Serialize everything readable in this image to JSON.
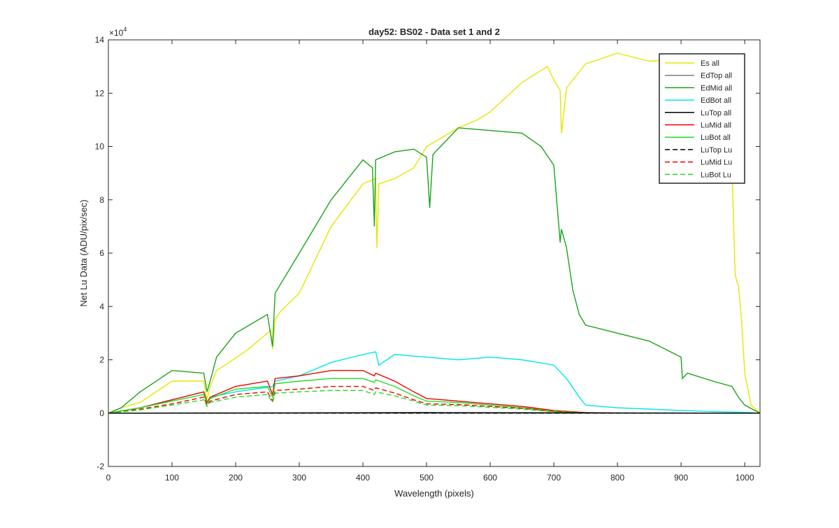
{
  "chart_data": {
    "type": "line",
    "title": "day52: BS02 - Data set 1 and 2",
    "xlabel": "Wavelength (pixels)",
    "ylabel": "Net Lu Data (ADU/pix/sec)",
    "y_exponent_label": "×10",
    "y_exponent_power": "4",
    "xlim": [
      0,
      1024
    ],
    "ylim": [
      -2,
      14
    ],
    "xticks": [
      0,
      100,
      200,
      300,
      400,
      500,
      600,
      700,
      800,
      900,
      1000
    ],
    "yticks": [
      -2,
      0,
      2,
      4,
      6,
      8,
      10,
      12,
      14
    ],
    "legend_position": "top-right",
    "series": [
      {
        "name": "Es  all",
        "color": "#e6e600",
        "dash": "solid",
        "x": [
          0,
          20,
          50,
          100,
          150,
          155,
          160,
          170,
          190,
          220,
          240,
          255,
          258,
          262,
          270,
          300,
          350,
          400,
          420,
          422,
          425,
          450,
          480,
          500,
          550,
          580,
          600,
          650,
          690,
          700,
          710,
          712,
          720,
          750,
          800,
          850,
          900,
          950,
          975,
          980,
          985,
          988,
          990,
          995,
          1000,
          1010,
          1024
        ],
        "y": [
          0,
          0.2,
          0.4,
          1.2,
          1.2,
          0.5,
          1.0,
          1.6,
          1.9,
          2.4,
          2.8,
          3.1,
          2.4,
          3.5,
          3.8,
          4.5,
          7.0,
          8.6,
          8.8,
          6.2,
          8.6,
          8.8,
          9.2,
          10.0,
          10.7,
          11.0,
          11.3,
          12.4,
          13.0,
          12.5,
          12.1,
          10.5,
          12.2,
          13.1,
          13.5,
          13.2,
          13.3,
          13.3,
          13.0,
          9.0,
          5.2,
          4.9,
          4.8,
          3.5,
          1.5,
          0.3,
          0
        ]
      },
      {
        "name": "EdTop  all",
        "color": "#808080",
        "dash": "solid",
        "x": [
          0,
          500,
          1024
        ],
        "y": [
          0,
          0,
          0
        ]
      },
      {
        "name": "EdMid  all",
        "color": "#1aa31a",
        "dash": "solid",
        "x": [
          0,
          20,
          50,
          100,
          150,
          155,
          160,
          170,
          200,
          250,
          258,
          262,
          300,
          350,
          400,
          415,
          418,
          420,
          450,
          480,
          500,
          505,
          510,
          550,
          600,
          650,
          680,
          700,
          710,
          712,
          720,
          730,
          740,
          750,
          800,
          850,
          900,
          902,
          910,
          950,
          980,
          990,
          1000,
          1024
        ],
        "y": [
          0,
          0.2,
          0.8,
          1.6,
          1.5,
          0.8,
          1.2,
          2.1,
          3.0,
          3.7,
          2.5,
          4.5,
          6.0,
          8.0,
          9.5,
          9.2,
          7.0,
          9.5,
          9.8,
          9.9,
          9.6,
          7.7,
          9.7,
          10.7,
          10.6,
          10.5,
          10.0,
          9.3,
          6.4,
          6.9,
          6.2,
          4.6,
          3.7,
          3.3,
          3.0,
          2.7,
          2.1,
          1.3,
          1.5,
          1.2,
          1.0,
          0.6,
          0.3,
          0
        ]
      },
      {
        "name": "EdBot  all",
        "color": "#00e5ee",
        "dash": "solid",
        "x": [
          0,
          50,
          100,
          150,
          155,
          160,
          200,
          258,
          262,
          300,
          350,
          400,
          420,
          425,
          450,
          500,
          550,
          600,
          650,
          700,
          720,
          740,
          750,
          800,
          850,
          900,
          950,
          1000,
          1024
        ],
        "y": [
          0,
          0.2,
          0.5,
          0.8,
          0.4,
          0.6,
          0.8,
          1.0,
          1.2,
          1.4,
          1.9,
          2.2,
          2.3,
          1.8,
          2.2,
          2.1,
          2.0,
          2.1,
          2.0,
          1.8,
          1.3,
          0.6,
          0.3,
          0.2,
          0.15,
          0.1,
          0.06,
          0.03,
          0
        ]
      },
      {
        "name": "LuTop  all",
        "color": "#000000",
        "dash": "solid",
        "x": [
          0,
          500,
          1024
        ],
        "y": [
          0,
          0.02,
          0
        ]
      },
      {
        "name": "LuMid  all",
        "color": "#ee0000",
        "dash": "solid",
        "x": [
          0,
          50,
          100,
          150,
          155,
          160,
          200,
          250,
          258,
          262,
          300,
          350,
          400,
          418,
          420,
          450,
          480,
          500,
          550,
          600,
          650,
          700,
          750,
          800,
          900,
          1024
        ],
        "y": [
          0,
          0.2,
          0.5,
          0.8,
          0.4,
          0.6,
          1.0,
          1.2,
          0.7,
          1.3,
          1.4,
          1.6,
          1.6,
          1.4,
          1.5,
          1.2,
          0.8,
          0.55,
          0.45,
          0.35,
          0.25,
          0.1,
          0.02,
          0,
          0,
          0
        ]
      },
      {
        "name": "LuBot  all",
        "color": "#22dd22",
        "dash": "solid",
        "x": [
          0,
          50,
          100,
          150,
          155,
          160,
          200,
          250,
          258,
          262,
          300,
          350,
          400,
          418,
          420,
          450,
          480,
          500,
          550,
          600,
          650,
          700,
          750,
          800,
          900,
          1024
        ],
        "y": [
          0,
          0.2,
          0.45,
          0.7,
          0.35,
          0.55,
          0.9,
          1.0,
          0.6,
          1.1,
          1.2,
          1.3,
          1.3,
          1.15,
          1.25,
          1.0,
          0.65,
          0.45,
          0.4,
          0.3,
          0.2,
          0.08,
          0.01,
          0,
          0,
          0
        ]
      },
      {
        "name": "LuTop  Lu",
        "color": "#000000",
        "dash": "dashed",
        "x": [
          0,
          500,
          1024
        ],
        "y": [
          0,
          0,
          0
        ]
      },
      {
        "name": "LuMid  Lu",
        "color": "#ee0000",
        "dash": "dashed",
        "x": [
          0,
          50,
          100,
          150,
          155,
          160,
          200,
          250,
          258,
          262,
          300,
          350,
          400,
          418,
          420,
          450,
          480,
          500,
          550,
          600,
          650,
          700,
          750,
          800,
          1024
        ],
        "y": [
          0,
          0.15,
          0.35,
          0.6,
          0.3,
          0.45,
          0.7,
          0.8,
          0.45,
          0.85,
          0.9,
          1.0,
          1.0,
          0.85,
          0.95,
          0.75,
          0.5,
          0.35,
          0.32,
          0.25,
          0.18,
          0.07,
          0.01,
          0,
          0
        ]
      },
      {
        "name": "LuBot  Lu",
        "color": "#22dd22",
        "dash": "dashed",
        "x": [
          0,
          50,
          100,
          150,
          155,
          160,
          200,
          250,
          258,
          262,
          300,
          350,
          400,
          418,
          420,
          450,
          480,
          500,
          550,
          600,
          650,
          700,
          750,
          800,
          1024
        ],
        "y": [
          0,
          0.12,
          0.3,
          0.5,
          0.25,
          0.4,
          0.6,
          0.7,
          0.4,
          0.75,
          0.8,
          0.85,
          0.85,
          0.7,
          0.8,
          0.65,
          0.45,
          0.3,
          0.28,
          0.22,
          0.15,
          0.05,
          0.01,
          0,
          0
        ]
      }
    ]
  }
}
